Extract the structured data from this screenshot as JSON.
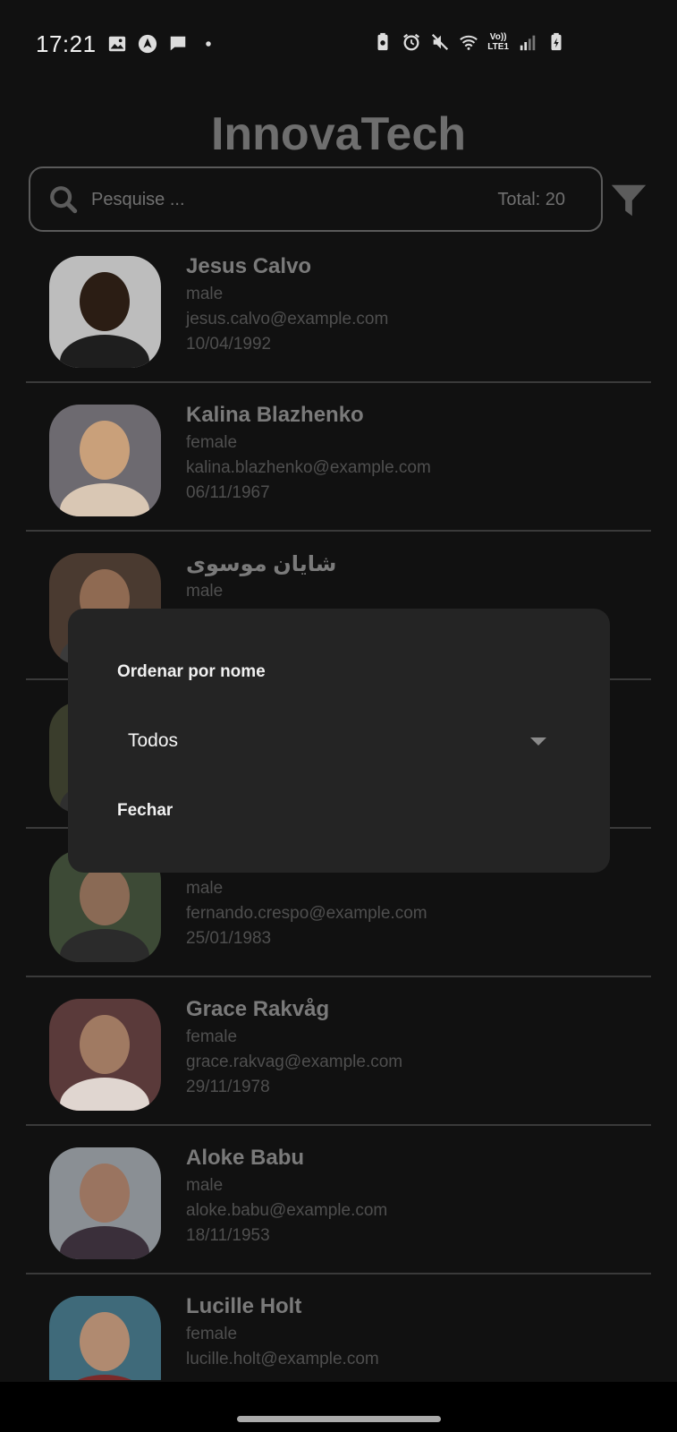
{
  "status_bar": {
    "time": "17:21",
    "lte_top": "Vo))",
    "lte_bottom": "LTE1",
    "icons_left": [
      "gallery-icon",
      "navigation-icon",
      "message-icon",
      "dot-icon"
    ],
    "icons_right": [
      "battery-saver-icon",
      "alarm-icon",
      "mute-icon",
      "wifi-icon",
      "volte-icon",
      "signal-icon",
      "battery-icon"
    ]
  },
  "app": {
    "title": "InnovaTech"
  },
  "search": {
    "placeholder": "Pesquise ...",
    "total": "Total: 20"
  },
  "users": [
    {
      "name": "Jesus Calvo",
      "gender": "male",
      "email": "jesus.calvo@example.com",
      "dob": "10/04/1992"
    },
    {
      "name": "Kalina Blazhenko",
      "gender": "female",
      "email": "kalina.blazhenko@example.com",
      "dob": "06/11/1967"
    },
    {
      "name": "شایان موسوی",
      "gender": "male",
      "email": "",
      "dob": ""
    },
    {
      "name": "",
      "gender": "",
      "email": "",
      "dob": ""
    },
    {
      "name": "",
      "gender": "male",
      "email": "fernando.crespo@example.com",
      "dob": "25/01/1983"
    },
    {
      "name": "Grace Rakvåg",
      "gender": "female",
      "email": "grace.rakvag@example.com",
      "dob": "29/11/1978"
    },
    {
      "name": "Aloke Babu",
      "gender": "male",
      "email": "aloke.babu@example.com",
      "dob": "18/11/1953"
    },
    {
      "name": "Lucille Holt",
      "gender": "female",
      "email": "lucille.holt@example.com",
      "dob": ""
    }
  ],
  "dialog": {
    "title": "Ordenar por nome",
    "select_value": "Todos",
    "close_label": "Fechar"
  },
  "colors": {
    "background": "#111111",
    "dialog_bg": "#242424",
    "name_text": "#7a7a7a",
    "detail_text": "#4f4f4f"
  }
}
